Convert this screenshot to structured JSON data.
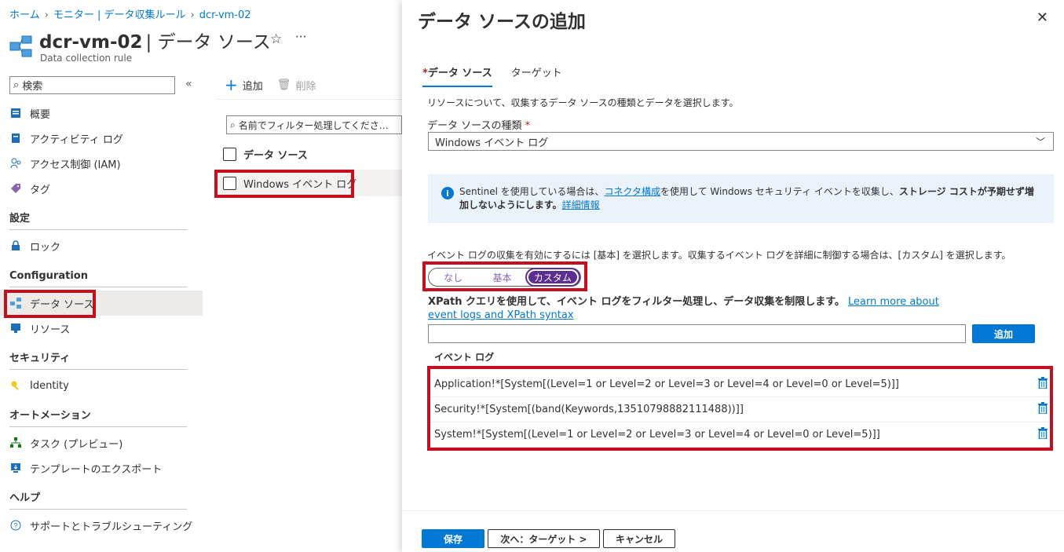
{
  "breadcrumb": [
    "ホーム",
    "モニター | データ収集ルール",
    "dcr-vm-02"
  ],
  "header": {
    "resource_name": "dcr-vm-02",
    "page_name": "| データ ソース",
    "subtitle": "Data collection rule",
    "star": "☆",
    "more": "···"
  },
  "nav": {
    "search_placeholder": "検索",
    "collapse": "«",
    "items_top": [
      {
        "label": "概要",
        "icon": "overview-icon"
      },
      {
        "label": "アクティビティ ログ",
        "icon": "activity-log-icon"
      },
      {
        "label": "アクセス制御 (IAM)",
        "icon": "iam-icon"
      },
      {
        "label": "タグ",
        "icon": "tag-icon"
      }
    ],
    "sections": {
      "settings": "設定",
      "configuration": "Configuration",
      "security": "セキュリティ",
      "automation": "オートメーション",
      "help": "ヘルプ"
    },
    "lock": "ロック",
    "data_sources": "データ ソース",
    "resources": "リソース",
    "identity": "Identity",
    "tasks": "タスク (プレビュー)",
    "export_template": "テンプレートのエクスポート",
    "support": "サポートとトラブルシューティング"
  },
  "toolbar": {
    "add": "追加",
    "delete": "削除"
  },
  "filter_placeholder": "名前でフィルター処理してくださ…",
  "grid": {
    "header": "データ ソース",
    "row": "Windows イベント ログ"
  },
  "panel": {
    "title": "データ ソースの追加",
    "close": "✕",
    "tabs": {
      "data_source": "データ ソース",
      "target": "ターゲット",
      "required_mark": "*"
    },
    "description": "リソースについて、収集するデータ ソースの種類とデータを選択します。",
    "type_label": "データ ソースの種類",
    "type_value": "Windows イベント ログ",
    "info": {
      "pre": "Sentinel を使用している場合は、",
      "link1": "コネクタ構成",
      "mid": "を使用して Windows セキュリティ イベントを収集し、",
      "bold": "ストレージ コストが予期せず増加しないようにします。",
      "link2": "詳細情報"
    },
    "hint": "イベント ログの収集を有効にするには [基本] を選択します。収集するイベント ログを詳細に制御する場合は、[カスタム] を選択します。",
    "toggle": [
      "なし",
      "基本",
      "カスタム"
    ],
    "xpath_text": "XPath クエリを使用して、イベント ログをフィルター処理し、データ収集を制限します。",
    "xpath_link": "Learn more about event logs and XPath syntax",
    "add_button": "追加",
    "event_log_label": "イベント ログ",
    "event_logs": [
      "Application!*[System[(Level=1 or Level=2 or Level=3 or Level=4 or Level=0 or Level=5)]]",
      "Security!*[System[(band(Keywords,13510798882111488))]]",
      "System!*[System[(Level=1 or Level=2 or Level=3 or Level=4 or Level=0 or Level=5)]]"
    ],
    "footer": {
      "save": "保存",
      "next": "次へ：ターゲット >",
      "cancel": "キャンセル"
    }
  }
}
